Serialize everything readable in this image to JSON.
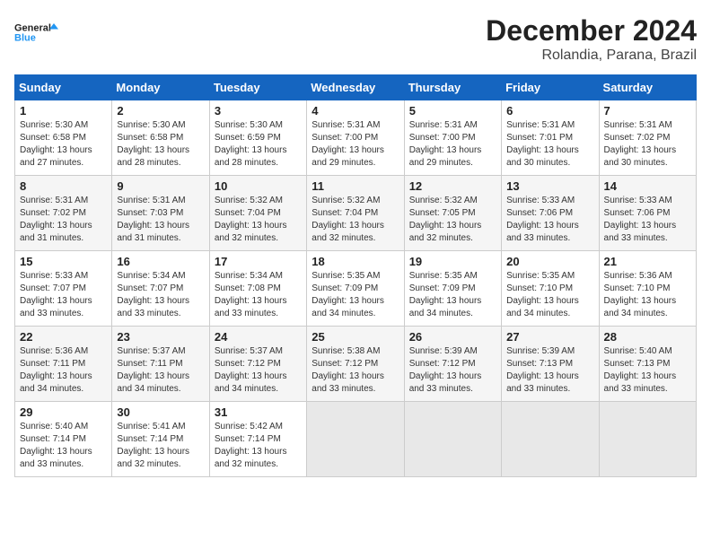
{
  "logo": {
    "line1": "General",
    "line2": "Blue"
  },
  "title": "December 2024",
  "subtitle": "Rolandia, Parana, Brazil",
  "weekdays": [
    "Sunday",
    "Monday",
    "Tuesday",
    "Wednesday",
    "Thursday",
    "Friday",
    "Saturday"
  ],
  "weeks": [
    [
      {
        "day": "1",
        "info": "Sunrise: 5:30 AM\nSunset: 6:58 PM\nDaylight: 13 hours\nand 27 minutes."
      },
      {
        "day": "2",
        "info": "Sunrise: 5:30 AM\nSunset: 6:58 PM\nDaylight: 13 hours\nand 28 minutes."
      },
      {
        "day": "3",
        "info": "Sunrise: 5:30 AM\nSunset: 6:59 PM\nDaylight: 13 hours\nand 28 minutes."
      },
      {
        "day": "4",
        "info": "Sunrise: 5:31 AM\nSunset: 7:00 PM\nDaylight: 13 hours\nand 29 minutes."
      },
      {
        "day": "5",
        "info": "Sunrise: 5:31 AM\nSunset: 7:00 PM\nDaylight: 13 hours\nand 29 minutes."
      },
      {
        "day": "6",
        "info": "Sunrise: 5:31 AM\nSunset: 7:01 PM\nDaylight: 13 hours\nand 30 minutes."
      },
      {
        "day": "7",
        "info": "Sunrise: 5:31 AM\nSunset: 7:02 PM\nDaylight: 13 hours\nand 30 minutes."
      }
    ],
    [
      {
        "day": "8",
        "info": "Sunrise: 5:31 AM\nSunset: 7:02 PM\nDaylight: 13 hours\nand 31 minutes."
      },
      {
        "day": "9",
        "info": "Sunrise: 5:31 AM\nSunset: 7:03 PM\nDaylight: 13 hours\nand 31 minutes."
      },
      {
        "day": "10",
        "info": "Sunrise: 5:32 AM\nSunset: 7:04 PM\nDaylight: 13 hours\nand 32 minutes."
      },
      {
        "day": "11",
        "info": "Sunrise: 5:32 AM\nSunset: 7:04 PM\nDaylight: 13 hours\nand 32 minutes."
      },
      {
        "day": "12",
        "info": "Sunrise: 5:32 AM\nSunset: 7:05 PM\nDaylight: 13 hours\nand 32 minutes."
      },
      {
        "day": "13",
        "info": "Sunrise: 5:33 AM\nSunset: 7:06 PM\nDaylight: 13 hours\nand 33 minutes."
      },
      {
        "day": "14",
        "info": "Sunrise: 5:33 AM\nSunset: 7:06 PM\nDaylight: 13 hours\nand 33 minutes."
      }
    ],
    [
      {
        "day": "15",
        "info": "Sunrise: 5:33 AM\nSunset: 7:07 PM\nDaylight: 13 hours\nand 33 minutes."
      },
      {
        "day": "16",
        "info": "Sunrise: 5:34 AM\nSunset: 7:07 PM\nDaylight: 13 hours\nand 33 minutes."
      },
      {
        "day": "17",
        "info": "Sunrise: 5:34 AM\nSunset: 7:08 PM\nDaylight: 13 hours\nand 33 minutes."
      },
      {
        "day": "18",
        "info": "Sunrise: 5:35 AM\nSunset: 7:09 PM\nDaylight: 13 hours\nand 34 minutes."
      },
      {
        "day": "19",
        "info": "Sunrise: 5:35 AM\nSunset: 7:09 PM\nDaylight: 13 hours\nand 34 minutes."
      },
      {
        "day": "20",
        "info": "Sunrise: 5:35 AM\nSunset: 7:10 PM\nDaylight: 13 hours\nand 34 minutes."
      },
      {
        "day": "21",
        "info": "Sunrise: 5:36 AM\nSunset: 7:10 PM\nDaylight: 13 hours\nand 34 minutes."
      }
    ],
    [
      {
        "day": "22",
        "info": "Sunrise: 5:36 AM\nSunset: 7:11 PM\nDaylight: 13 hours\nand 34 minutes."
      },
      {
        "day": "23",
        "info": "Sunrise: 5:37 AM\nSunset: 7:11 PM\nDaylight: 13 hours\nand 34 minutes."
      },
      {
        "day": "24",
        "info": "Sunrise: 5:37 AM\nSunset: 7:12 PM\nDaylight: 13 hours\nand 34 minutes."
      },
      {
        "day": "25",
        "info": "Sunrise: 5:38 AM\nSunset: 7:12 PM\nDaylight: 13 hours\nand 33 minutes."
      },
      {
        "day": "26",
        "info": "Sunrise: 5:39 AM\nSunset: 7:12 PM\nDaylight: 13 hours\nand 33 minutes."
      },
      {
        "day": "27",
        "info": "Sunrise: 5:39 AM\nSunset: 7:13 PM\nDaylight: 13 hours\nand 33 minutes."
      },
      {
        "day": "28",
        "info": "Sunrise: 5:40 AM\nSunset: 7:13 PM\nDaylight: 13 hours\nand 33 minutes."
      }
    ],
    [
      {
        "day": "29",
        "info": "Sunrise: 5:40 AM\nSunset: 7:14 PM\nDaylight: 13 hours\nand 33 minutes."
      },
      {
        "day": "30",
        "info": "Sunrise: 5:41 AM\nSunset: 7:14 PM\nDaylight: 13 hours\nand 32 minutes."
      },
      {
        "day": "31",
        "info": "Sunrise: 5:42 AM\nSunset: 7:14 PM\nDaylight: 13 hours\nand 32 minutes."
      },
      {
        "day": "",
        "info": ""
      },
      {
        "day": "",
        "info": ""
      },
      {
        "day": "",
        "info": ""
      },
      {
        "day": "",
        "info": ""
      }
    ]
  ]
}
